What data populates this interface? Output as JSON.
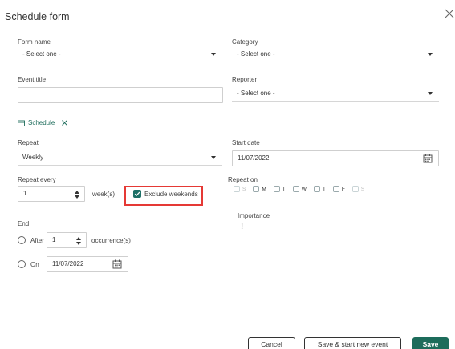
{
  "dialog": {
    "title": "Schedule form"
  },
  "form_name": {
    "label": "Form name",
    "value": "- Select one -"
  },
  "category": {
    "label": "Category",
    "value": "- Select one -"
  },
  "event_title": {
    "label": "Event title",
    "value": ""
  },
  "reporter": {
    "label": "Reporter",
    "value": "- Select one -"
  },
  "schedule_section": {
    "label": "Schedule"
  },
  "repeat": {
    "label": "Repeat",
    "value": "Weekly"
  },
  "start_date": {
    "label": "Start date",
    "value": "11/07/2022"
  },
  "repeat_every": {
    "label": "Repeat every",
    "value": "1",
    "unit": "week(s)"
  },
  "exclude_weekends": {
    "label": "Exclude weekends",
    "checked": true
  },
  "repeat_on": {
    "label": "Repeat on",
    "days": [
      {
        "label": "S",
        "enabled": false
      },
      {
        "label": "M",
        "enabled": true
      },
      {
        "label": "T",
        "enabled": true
      },
      {
        "label": "W",
        "enabled": true
      },
      {
        "label": "T",
        "enabled": true
      },
      {
        "label": "F",
        "enabled": true
      },
      {
        "label": "S",
        "enabled": false
      }
    ]
  },
  "importance": {
    "label": "Importance",
    "marker": "!"
  },
  "end": {
    "label": "End",
    "after": {
      "label": "After",
      "value": "1",
      "unit": "occurrence(s)"
    },
    "on": {
      "label": "On",
      "value": "11/07/2022"
    }
  },
  "footer": {
    "cancel_label": "Cancel",
    "save_new_label": "Save & start new event",
    "save_label": "Save"
  },
  "colors": {
    "accent": "#1d6c5b",
    "highlight": "#e53935"
  }
}
